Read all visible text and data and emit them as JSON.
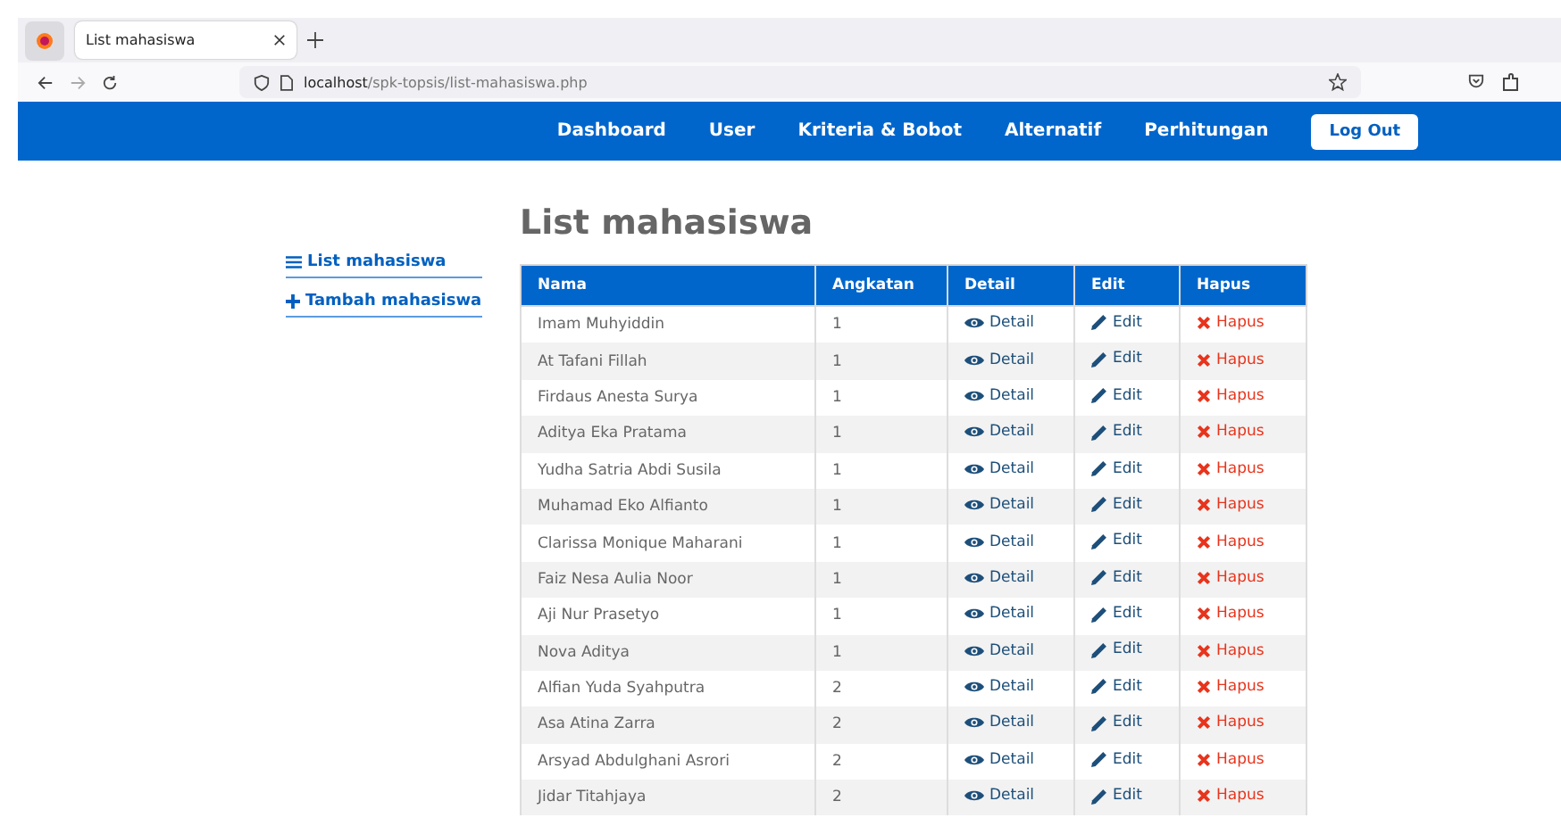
{
  "browser": {
    "tab_title": "List mahasiswa",
    "url_host": "localhost",
    "url_path": "/spk-topsis/list-mahasiswa.php"
  },
  "nav": {
    "items": [
      "Dashboard",
      "User",
      "Kriteria & Bobot",
      "Alternatif",
      "Perhitungan"
    ],
    "logout": "Log Out"
  },
  "sidebar": {
    "items": [
      {
        "label": "List mahasiswa",
        "kind": "list"
      },
      {
        "label": "Tambah mahasiswa",
        "kind": "add"
      }
    ]
  },
  "title": "List mahasiswa",
  "table": {
    "columns": [
      "Nama",
      "Angkatan",
      "Detail",
      "Edit",
      "Hapus"
    ],
    "rows": [
      {
        "nama": "Imam Muhyiddin",
        "angkatan": "1",
        "detail": "Detail",
        "edit": "Edit",
        "hapus": "Hapus"
      },
      {
        "nama": "At Tafani Fillah",
        "angkatan": "1",
        "detail": "Detail",
        "edit": "Edit",
        "hapus": "Hapus"
      },
      {
        "nama": "Firdaus Anesta Surya",
        "angkatan": "1",
        "detail": "Detail",
        "edit": "Edit",
        "hapus": "Hapus"
      },
      {
        "nama": "Aditya Eka Pratama",
        "angkatan": "1",
        "detail": "Detail",
        "edit": "Edit",
        "hapus": "Hapus"
      },
      {
        "nama": "Yudha Satria Abdi Susila",
        "angkatan": "1",
        "detail": "Detail",
        "edit": "Edit",
        "hapus": "Hapus"
      },
      {
        "nama": "Muhamad Eko Alfianto",
        "angkatan": "1",
        "detail": "Detail",
        "edit": "Edit",
        "hapus": "Hapus"
      },
      {
        "nama": "Clarissa Monique Maharani",
        "angkatan": "1",
        "detail": "Detail",
        "edit": "Edit",
        "hapus": "Hapus"
      },
      {
        "nama": "Faiz Nesa Aulia Noor",
        "angkatan": "1",
        "detail": "Detail",
        "edit": "Edit",
        "hapus": "Hapus"
      },
      {
        "nama": "Aji Nur Prasetyo",
        "angkatan": "1",
        "detail": "Detail",
        "edit": "Edit",
        "hapus": "Hapus"
      },
      {
        "nama": "Nova Aditya",
        "angkatan": "1",
        "detail": "Detail",
        "edit": "Edit",
        "hapus": "Hapus"
      },
      {
        "nama": "Alfian Yuda Syahputra",
        "angkatan": "2",
        "detail": "Detail",
        "edit": "Edit",
        "hapus": "Hapus"
      },
      {
        "nama": "Asa Atina Zarra",
        "angkatan": "2",
        "detail": "Detail",
        "edit": "Edit",
        "hapus": "Hapus"
      },
      {
        "nama": "Arsyad Abdulghani Asrori",
        "angkatan": "2",
        "detail": "Detail",
        "edit": "Edit",
        "hapus": "Hapus"
      },
      {
        "nama": "Jidar Titahjaya",
        "angkatan": "2",
        "detail": "Detail",
        "edit": "Edit",
        "hapus": "Hapus"
      }
    ]
  }
}
